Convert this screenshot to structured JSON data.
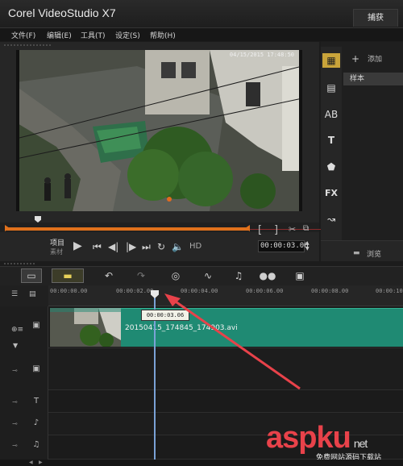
{
  "app": {
    "title": "Corel VideoStudio X7",
    "capture_tab": "捕获"
  },
  "menu": [
    "文件(F)",
    "编辑(E)",
    "工具(T)",
    "设定(S)",
    "帮助(H)"
  ],
  "video": {
    "timestamp": "04/15/2015 17:48:50"
  },
  "player": {
    "mode_project": "项目",
    "mode_clip": "素材",
    "hd_label": "HD",
    "bracket_in": "[",
    "bracket_out": "]",
    "timecode": "00:00:03.06"
  },
  "library": {
    "add_label": "添加",
    "sample_label": "样本",
    "browse_label": "浏览",
    "icons": [
      "media-icon",
      "instant-project-icon",
      "transition-icon",
      "title-icon",
      "graphic-icon",
      "fx-icon",
      "path-icon"
    ]
  },
  "timeline": {
    "ruler_ticks": [
      "00:00:00.00",
      "00:00:02.00",
      "00:00:04.00",
      "00:00:06.00",
      "00:00:08.00",
      "00:00:10"
    ],
    "tooltip_time": "00:00:03.06",
    "clip_name": "20150415_174845_174903.avi"
  },
  "watermark": {
    "main": "aspku",
    "suffix": "net",
    "sub": "免费网站源码下载站"
  },
  "colors": {
    "accent_orange": "#e0711c",
    "clip_teal": "#1f8a73",
    "playhead_blue": "#7aa2d6",
    "watermark_red": "#e8424a"
  }
}
